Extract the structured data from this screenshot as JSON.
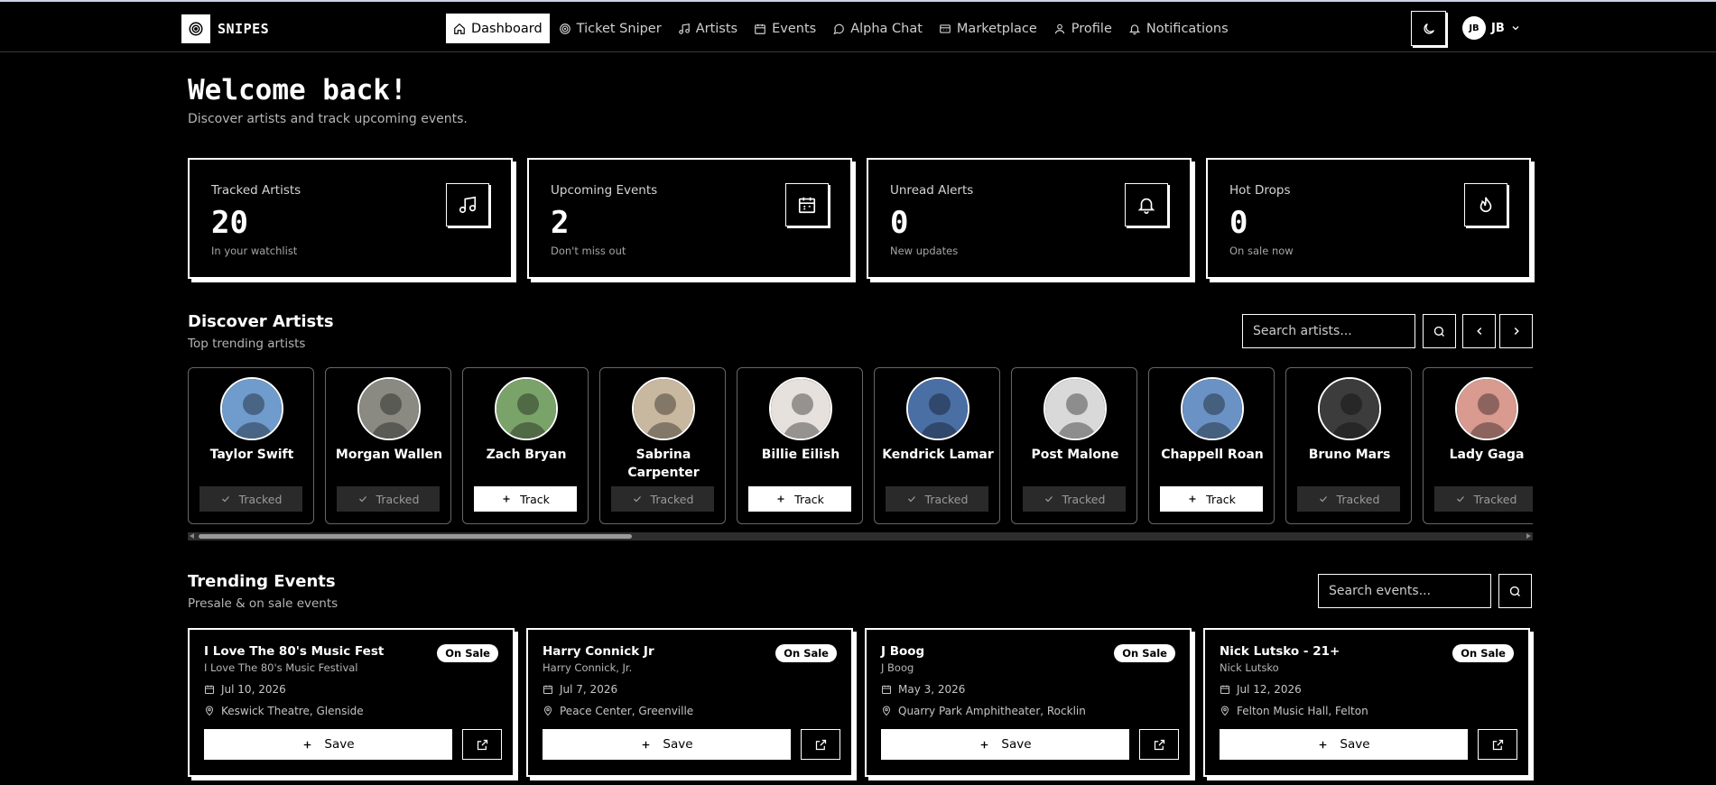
{
  "brand": {
    "name": "SNIPES",
    "logo_icon": "target-icon"
  },
  "nav": [
    {
      "label": "Dashboard",
      "icon": "home-icon",
      "active": true
    },
    {
      "label": "Ticket Sniper",
      "icon": "target-icon"
    },
    {
      "label": "Artists",
      "icon": "music-note-icon"
    },
    {
      "label": "Events",
      "icon": "calendar-icon"
    },
    {
      "label": "Alpha Chat",
      "icon": "chat-bubble-icon"
    },
    {
      "label": "Marketplace",
      "icon": "store-icon"
    },
    {
      "label": "Profile",
      "icon": "user-icon"
    },
    {
      "label": "Notifications",
      "icon": "bell-icon"
    }
  ],
  "user": {
    "initials": "JB",
    "name": "JB"
  },
  "welcome": {
    "title": "Welcome back!",
    "subtitle": "Discover artists and track upcoming events."
  },
  "stats": [
    {
      "label": "Tracked Artists",
      "value": "20",
      "hint": "In your watchlist",
      "icon": "music-note-icon"
    },
    {
      "label": "Upcoming Events",
      "value": "2",
      "hint": "Don't miss out",
      "icon": "calendar-icon"
    },
    {
      "label": "Unread Alerts",
      "value": "0",
      "hint": "New updates",
      "icon": "bell-icon"
    },
    {
      "label": "Hot Drops",
      "value": "0",
      "hint": "On sale now",
      "icon": "flame-icon"
    }
  ],
  "discover": {
    "title": "Discover Artists",
    "subtitle": "Top trending artists",
    "search_placeholder": "Search artists...",
    "artists": [
      {
        "name": "Taylor Swift",
        "status": "Tracked",
        "photo_color": "#6f9ccc"
      },
      {
        "name": "Morgan Wallen",
        "status": "Tracked",
        "photo_color": "#8a8a82"
      },
      {
        "name": "Zach Bryan",
        "status": "Track",
        "photo_color": "#7aa36a"
      },
      {
        "name": "Sabrina Carpenter",
        "status": "Tracked",
        "photo_color": "#c9b8a0"
      },
      {
        "name": "Billie Eilish",
        "status": "Track",
        "photo_color": "#e6e1dc"
      },
      {
        "name": "Kendrick Lamar",
        "status": "Tracked",
        "photo_color": "#4a6fa5"
      },
      {
        "name": "Post Malone",
        "status": "Tracked",
        "photo_color": "#d9d9d9"
      },
      {
        "name": "Chappell Roan",
        "status": "Track",
        "photo_color": "#6a92c4"
      },
      {
        "name": "Bruno Mars",
        "status": "Tracked",
        "photo_color": "#3c3c3c"
      },
      {
        "name": "Lady Gaga",
        "status": "Tracked",
        "photo_color": "#d99a8f"
      }
    ]
  },
  "trending": {
    "title": "Trending Events",
    "subtitle": "Presale & on sale events",
    "search_placeholder": "Search events...",
    "save_label": "Save",
    "events": [
      {
        "name": "I Love The 80's Music Fest",
        "artist": "I Love The 80's Music Festival",
        "badge": "On Sale",
        "date": "Jul 10, 2026",
        "venue": "Keswick Theatre, Glenside"
      },
      {
        "name": "Harry Connick Jr",
        "artist": "Harry Connick, Jr.",
        "badge": "On Sale",
        "date": "Jul 7, 2026",
        "venue": "Peace Center, Greenville"
      },
      {
        "name": "J Boog",
        "artist": "J Boog",
        "badge": "On Sale",
        "date": "May 3, 2026",
        "venue": "Quarry Park Amphitheater, Rocklin"
      },
      {
        "name": "Nick Lutsko - 21+",
        "artist": "Nick Lutsko",
        "badge": "On Sale",
        "date": "Jul 12, 2026",
        "venue": "Felton Music Hall, Felton"
      }
    ]
  },
  "colors": {
    "background": "#000000",
    "foreground": "#ffffff",
    "tracked_bg": "#2a2a2a",
    "muted_text": "#b5b5b5"
  }
}
